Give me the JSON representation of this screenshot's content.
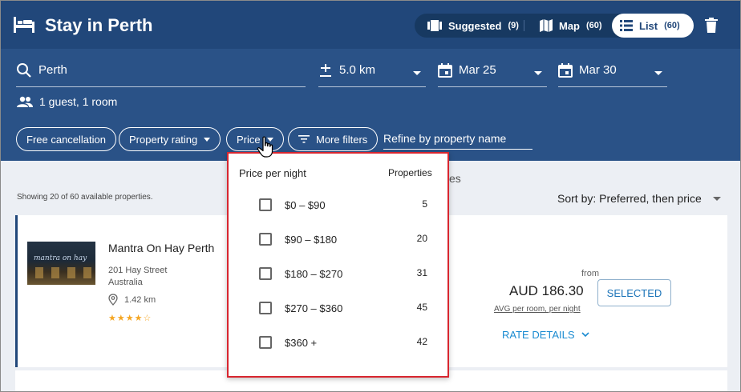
{
  "header": {
    "title": "Stay in Perth",
    "views": [
      {
        "label": "Suggested",
        "count": "(9)"
      },
      {
        "label": "Map",
        "count": "(60)"
      },
      {
        "label": "List",
        "count": "(60)"
      }
    ]
  },
  "search": {
    "location": "Perth",
    "radius": "5.0 km",
    "checkin": "Mar 25",
    "checkout": "Mar 30",
    "guests": "1 guest, 1 room"
  },
  "filters": {
    "free_cancellation": "Free cancellation",
    "property_rating": "Property rating",
    "price": "Price",
    "more_filters": "More filters",
    "refine_placeholder": "Refine by property name"
  },
  "results": {
    "showing": "Showing 20 of 60 available properties.",
    "sort_by": "Sort by: Preferred, then price",
    "hidden_fragment": "es"
  },
  "hotel": {
    "name": "Mantra On Hay Perth",
    "street": "201 Hay Street",
    "country": "Australia",
    "distance": "1.42 km",
    "stars": "★★★★☆",
    "thumb_sign": "mantra  on hay",
    "from": "from",
    "price": "AUD 186.30",
    "avg": "AVG per room, per night",
    "rate_details": "RATE DETAILS",
    "selected": "SELECTED"
  },
  "price_dropdown": {
    "title": "Price per night",
    "header": "Properties",
    "options": [
      {
        "label": "$0 – $90",
        "count": "5"
      },
      {
        "label": "$90 – $180",
        "count": "20"
      },
      {
        "label": "$180 – $270",
        "count": "31"
      },
      {
        "label": "$270 – $360",
        "count": "45"
      },
      {
        "label": "$360 +",
        "count": "42"
      }
    ]
  },
  "colors": {
    "header_bg": "#21477a",
    "band_bg": "#2a5287",
    "accent": "#1a8bd1",
    "dropdown_border": "#d8262f"
  }
}
